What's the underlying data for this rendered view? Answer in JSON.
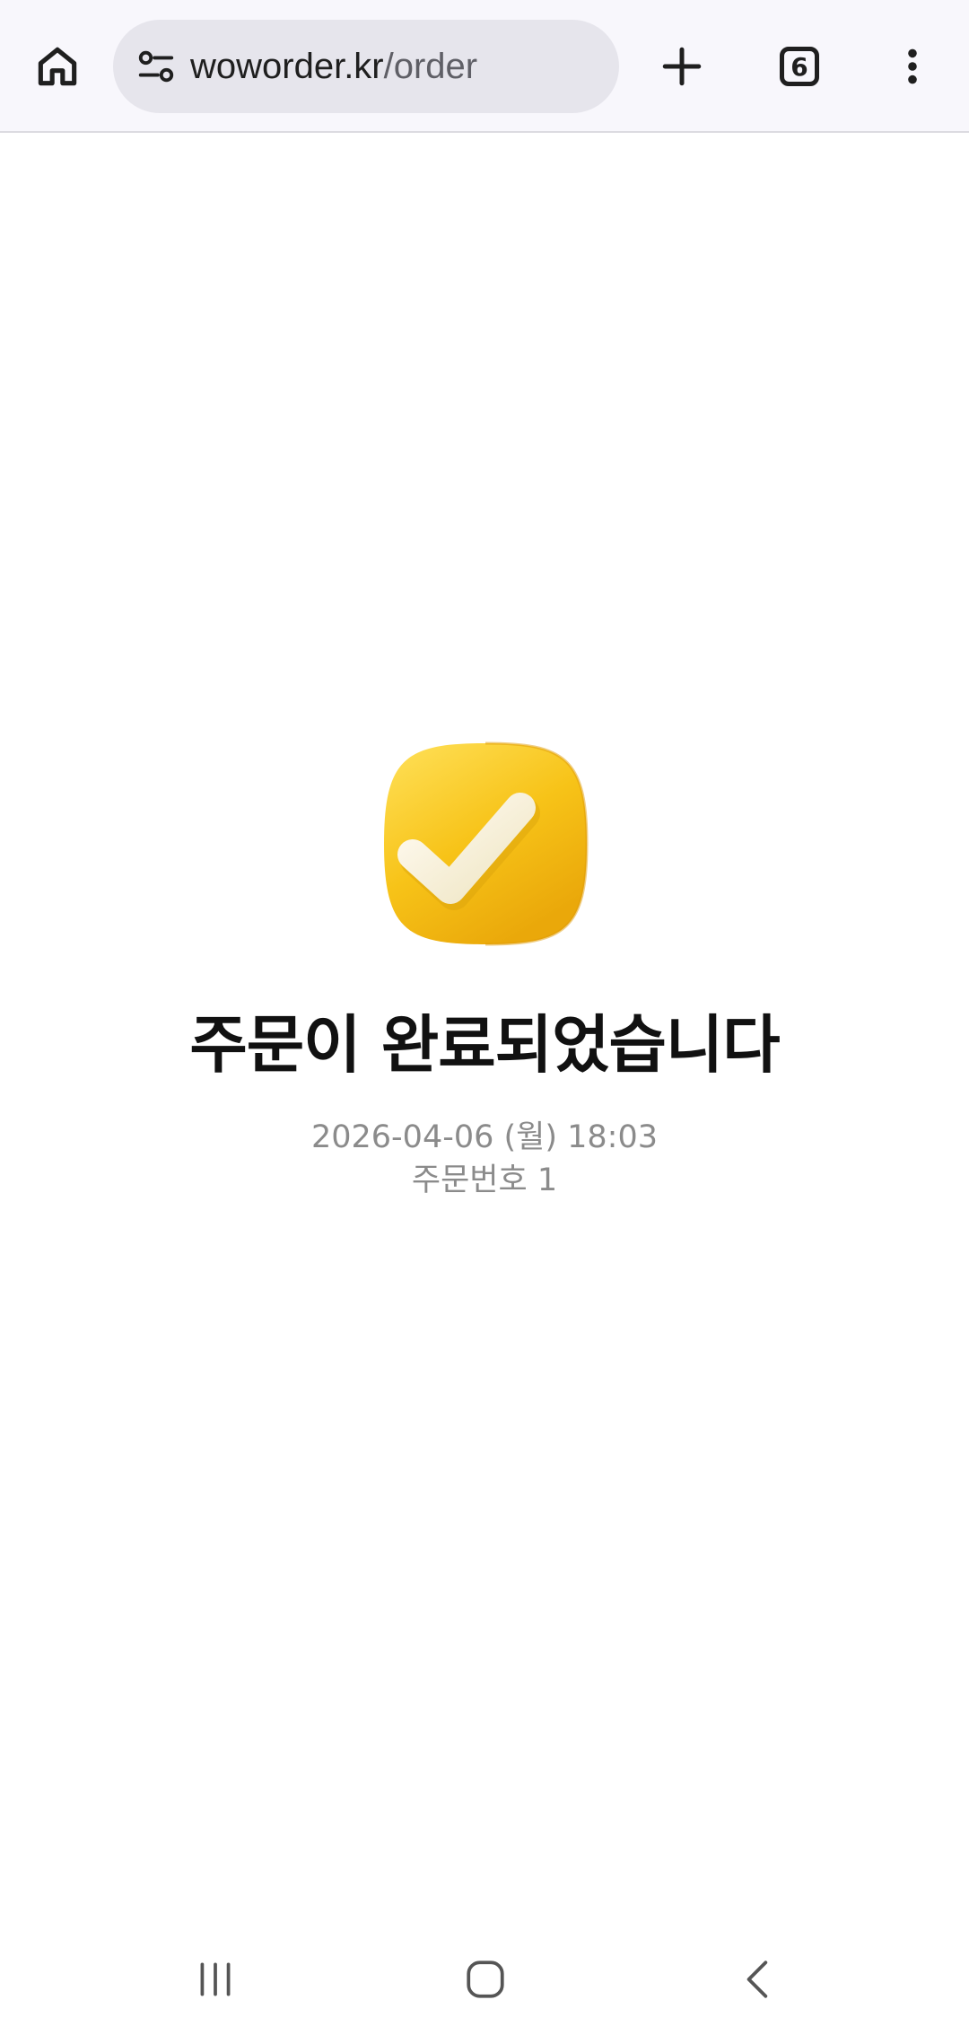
{
  "browser": {
    "url_domain": "woworder.kr",
    "url_path": "/order",
    "tab_count": "6",
    "icons": {
      "home": "home-icon",
      "site_info": "site-info-icon",
      "new_tab": "plus-icon",
      "tabs": "tab-switcher-icon",
      "menu": "more-vert-icon"
    }
  },
  "order_complete": {
    "badge_icon": "check-badge-icon",
    "title": "주문이 완료되었습니다",
    "date": "2026-04-06 (월) 18:03",
    "order_number": "주문번호 1",
    "colors": {
      "badge": "#f7c318",
      "check": "#f6f1dc",
      "title": "#111111",
      "meta": "#8b8b8b"
    }
  },
  "system_nav": {
    "icons": {
      "recents": "recents-icon",
      "home": "nav-home-icon",
      "back": "back-icon"
    }
  }
}
